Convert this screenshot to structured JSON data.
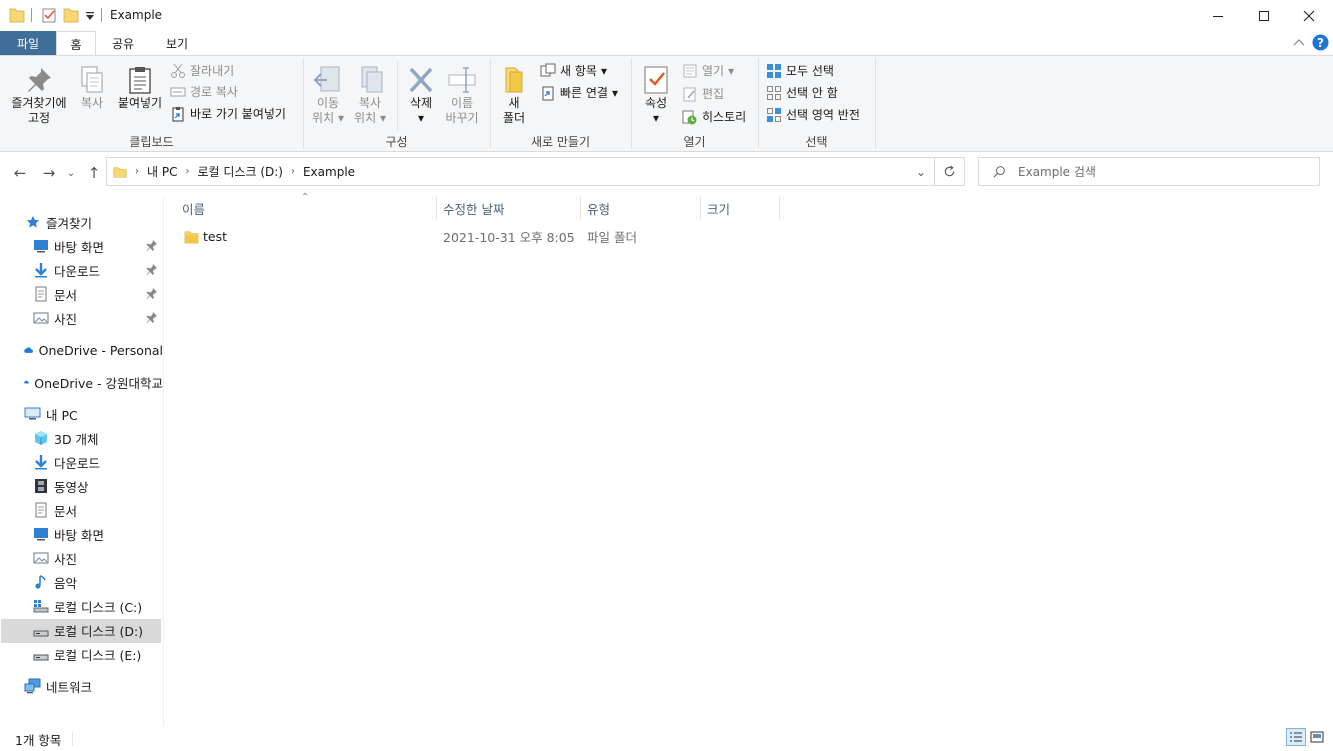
{
  "window": {
    "title": "Example"
  },
  "ribbon_tabs": {
    "file": "파일",
    "home": "홈",
    "share": "공유",
    "view": "보기"
  },
  "clipboard": {
    "pin_l1": "즐겨찾기에",
    "pin_l2": "고정",
    "copy": "복사",
    "paste": "붙여넣기",
    "cut": "잘라내기",
    "copy_path": "경로 복사",
    "paste_shortcut": "바로 가기 붙여넣기",
    "label": "클립보드"
  },
  "organize": {
    "move_l1": "이동",
    "move_l2": "위치",
    "copy_l1": "복사",
    "copy_l2": "위치",
    "delete": "삭제",
    "rename_l1": "이름",
    "rename_l2": "바꾸기",
    "label": "구성"
  },
  "new": {
    "folder_l1": "새",
    "folder_l2": "폴더",
    "new_item": "새 항목",
    "easy_access": "빠른 연결",
    "label": "새로 만들기"
  },
  "open": {
    "properties": "속성",
    "open": "열기",
    "edit": "편집",
    "history": "히스토리",
    "label": "열기"
  },
  "select": {
    "all": "모두 선택",
    "none": "선택 안 함",
    "invert": "선택 영역 반전",
    "label": "선택"
  },
  "address": {
    "crumbs": [
      "내 PC",
      "로컬 디스크 (D:)",
      "Example"
    ],
    "search_placeholder": "Example 검색"
  },
  "nav_pane": {
    "quick_access": "즐겨찾기",
    "quick_items": [
      "바탕 화면",
      "다운로드",
      "문서",
      "사진"
    ],
    "onedrive_personal": "OneDrive - Personal",
    "onedrive_org": "OneDrive - 강원대학교",
    "this_pc": "내 PC",
    "pc_items": [
      "3D 개체",
      "다운로드",
      "동영상",
      "문서",
      "바탕 화면",
      "사진",
      "음악",
      "로컬 디스크 (C:)",
      "로컬 디스크 (D:)",
      "로컬 디스크 (E:)"
    ],
    "network": "네트워크"
  },
  "columns": {
    "name": "이름",
    "modified": "수정한 날짜",
    "type": "유형",
    "size": "크기"
  },
  "files": [
    {
      "name": "test",
      "modified": "2021-10-31 오후 8:05",
      "type": "파일 폴더",
      "size": ""
    }
  ],
  "status": {
    "count": "1개 항목"
  },
  "colors": {
    "file_tab": "#3f6e98",
    "folder": "#f8d775",
    "selection": "#d9d9d9",
    "help": "#1c73d8"
  }
}
